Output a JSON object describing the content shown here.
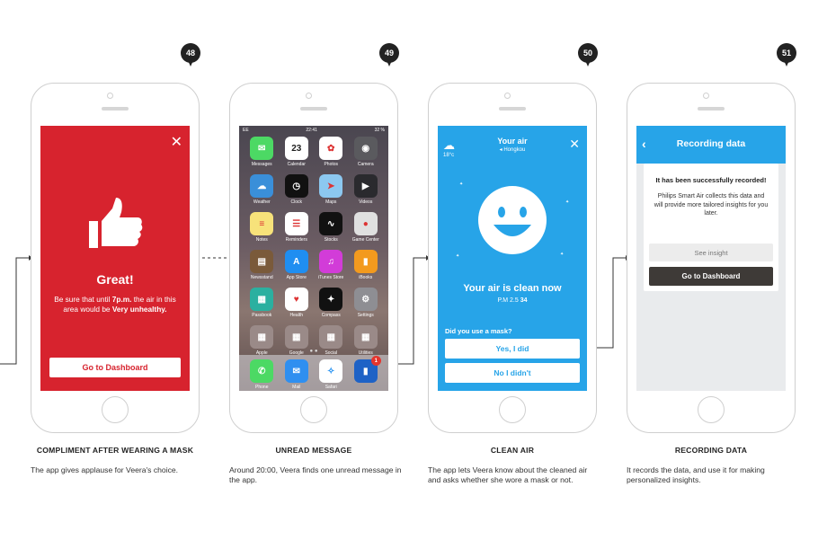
{
  "steps": [
    {
      "number": "48",
      "title": "COMPLIMENT AFTER WEARING A MASK",
      "description": "The app gives applause for Veera's choice."
    },
    {
      "number": "49",
      "title": "UNREAD MESSAGE",
      "description": "Around 20:00, Veera finds one unread message in the app."
    },
    {
      "number": "50",
      "title": "CLEAN AIR",
      "description": "The app lets Veera know about the cleaned air and asks whether she wore a mask or not."
    },
    {
      "number": "51",
      "title": "RECORDING DATA",
      "description": "It records the data, and use it for making personalized insights."
    }
  ],
  "screen1": {
    "heading": "Great!",
    "msg_a": "Be sure that until ",
    "msg_time": "7p.m.",
    "msg_b": " the air in this area would be ",
    "msg_warn": "Very unhealthy.",
    "button": "Go to Dashboard"
  },
  "screen2": {
    "carrier": "EE",
    "time": "22:41",
    "battery": "32 %",
    "apps": [
      {
        "label": "Messages",
        "icon": "messages-icon",
        "color": "#4cd964",
        "glyph": "✉"
      },
      {
        "label": "Calendar",
        "icon": "calendar-icon",
        "color": "#ffffff",
        "glyph": "23"
      },
      {
        "label": "Photos",
        "icon": "photos-icon",
        "color": "#ffffff",
        "glyph": "✿"
      },
      {
        "label": "Camera",
        "icon": "camera-icon",
        "color": "#5a5a5e",
        "glyph": "◉"
      },
      {
        "label": "Weather",
        "icon": "weather-icon",
        "color": "#3a8fd9",
        "glyph": "☁"
      },
      {
        "label": "Clock",
        "icon": "clock-icon",
        "color": "#111111",
        "glyph": "◷"
      },
      {
        "label": "Maps",
        "icon": "maps-icon",
        "color": "#8cc8f0",
        "glyph": "➤"
      },
      {
        "label": "Videos",
        "icon": "videos-icon",
        "color": "#2a2a2e",
        "glyph": "▶"
      },
      {
        "label": "Notes",
        "icon": "notes-icon",
        "color": "#f7e27a",
        "glyph": "≡"
      },
      {
        "label": "Reminders",
        "icon": "reminders-icon",
        "color": "#ffffff",
        "glyph": "☰"
      },
      {
        "label": "Stocks",
        "icon": "stocks-icon",
        "color": "#111111",
        "glyph": "∿"
      },
      {
        "label": "Game Center",
        "icon": "game-center-icon",
        "color": "#e0e0e0",
        "glyph": "●"
      },
      {
        "label": "Newsstand",
        "icon": "newsstand-icon",
        "color": "#7a5a3a",
        "glyph": "▤"
      },
      {
        "label": "App Store",
        "icon": "app-store-icon",
        "color": "#1f8ef1",
        "glyph": "A"
      },
      {
        "label": "iTunes Store",
        "icon": "itunes-store-icon",
        "color": "#d23cd8",
        "glyph": "♫"
      },
      {
        "label": "iBooks",
        "icon": "ibooks-icon",
        "color": "#f39a1e",
        "glyph": "▮"
      },
      {
        "label": "Passbook",
        "icon": "passbook-icon",
        "color": "#2bb0a0",
        "glyph": "▦"
      },
      {
        "label": "Health",
        "icon": "health-icon",
        "color": "#ffffff",
        "glyph": "♥"
      },
      {
        "label": "Compass",
        "icon": "compass-icon",
        "color": "#111111",
        "glyph": "✦"
      },
      {
        "label": "Settings",
        "icon": "settings-icon",
        "color": "#8e8e93",
        "glyph": "⚙"
      },
      {
        "label": "Apple",
        "icon": "apple-folder-icon",
        "color": "#9a8a88",
        "glyph": "▦"
      },
      {
        "label": "Google",
        "icon": "google-folder-icon",
        "color": "#9a8a88",
        "glyph": "▦"
      },
      {
        "label": "Social",
        "icon": "social-folder-icon",
        "color": "#9a8a88",
        "glyph": "▦"
      },
      {
        "label": "Utilities",
        "icon": "utilities-folder-icon",
        "color": "#9a8a88",
        "glyph": "▦"
      }
    ],
    "dock": [
      {
        "label": "Phone",
        "icon": "phone-icon",
        "color": "#4cd964",
        "glyph": "✆"
      },
      {
        "label": "Mail",
        "icon": "mail-icon",
        "color": "#2f8ff0",
        "glyph": "✉"
      },
      {
        "label": "Safari",
        "icon": "safari-icon",
        "color": "#ffffff",
        "glyph": "✧"
      },
      {
        "label": "",
        "icon": "philips-air-app-icon",
        "color": "#1e62c6",
        "glyph": "▮",
        "badge": "1"
      }
    ],
    "page_dots": "● ●"
  },
  "screen3": {
    "title": "Your air",
    "location": "◂ Hongkou",
    "temperature": "18°c",
    "status": "Your air is clean now",
    "pm_label": "P.M 2.5 ",
    "pm_value": "34",
    "question": "Did you use a mask?",
    "yes": "Yes, I did",
    "no": "No I didn't"
  },
  "screen4": {
    "title": "Recording data",
    "heading": "It has been successfully recorded!",
    "body": "Philips Smart Air collects this data and will provide more tailored insights for you later.",
    "see_insight": "See insight",
    "dashboard": "Go to Dashboard"
  },
  "colors": {
    "red": "#d7232e",
    "blue": "#27a4e8",
    "dark_button": "#3e3a37"
  }
}
